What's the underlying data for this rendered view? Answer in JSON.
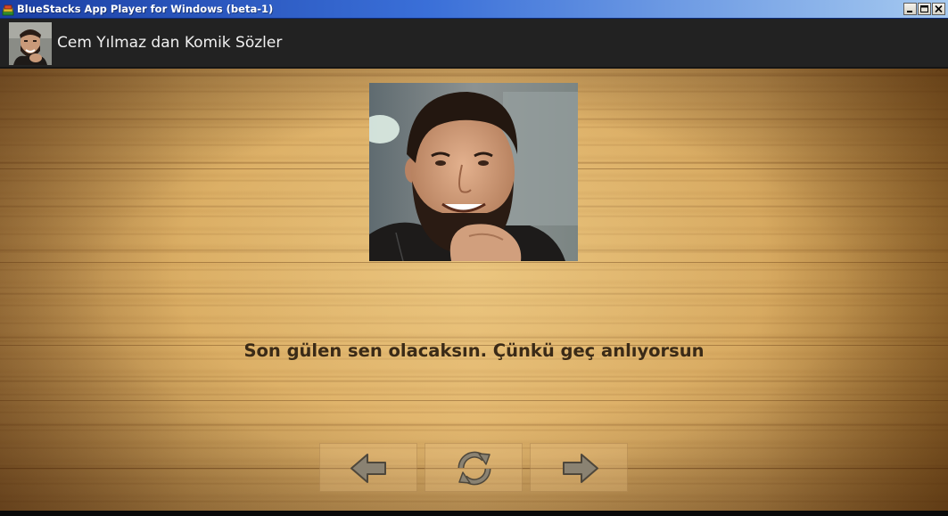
{
  "window": {
    "title": "BlueStacks App Player for Windows (beta-1)",
    "icon": "bluestacks-icon",
    "controls": [
      "minimize-icon",
      "maximize-icon",
      "close-icon"
    ]
  },
  "actionbar": {
    "title": "Cem Yılmaz dan Komik Sözler",
    "avatar": "app-avatar"
  },
  "content": {
    "photo": "portrait-photo",
    "quote": "Son gülen sen olacaksın. Çünkü geç anlıyorsun"
  },
  "controls": {
    "prev_icon": "arrow-left-icon",
    "refresh_icon": "refresh-icon",
    "next_icon": "arrow-right-icon"
  },
  "colors": {
    "titlebar": "#2f5fc8",
    "actionbar": "#222222",
    "wood": "#d9ab62",
    "quote_text": "#3a2a17"
  }
}
